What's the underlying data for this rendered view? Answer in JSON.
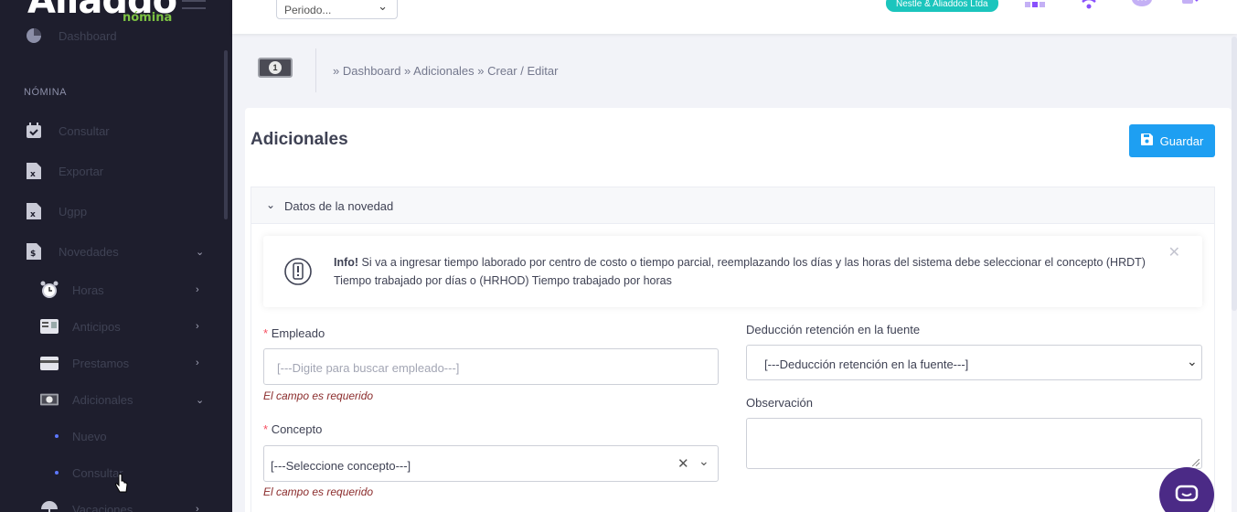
{
  "sidebar": {
    "logo": "Aliaddo",
    "logo_sub": "nómina",
    "top_item": "Dashboard",
    "section": "NÓMINA",
    "items": [
      {
        "label": "Consultar",
        "icon": "calendar-check-icon"
      },
      {
        "label": "Exportar",
        "icon": "excel-file-icon"
      },
      {
        "label": "Ugpp",
        "icon": "excel-file-icon"
      },
      {
        "label": "Novedades",
        "icon": "dollar-file-icon"
      }
    ],
    "novedades_items": [
      {
        "label": "Horas",
        "icon": "alarm-clock-icon"
      },
      {
        "label": "Anticipos",
        "icon": "id-card-icon"
      },
      {
        "label": "Prestamos",
        "icon": "credit-card-icon"
      },
      {
        "label": "Adicionales",
        "icon": "money-icon"
      }
    ],
    "adicionales_items": [
      {
        "label": "Nuevo"
      },
      {
        "label": "Consultar"
      }
    ],
    "bottom_item": "Vacaciones"
  },
  "header": {
    "periodo_placeholder": "Periodo...",
    "company": "Nestle & Aliaddos Ltda",
    "colors": {
      "company_badge": "#1bc5bd",
      "icon_purple": "#8950fc"
    }
  },
  "breadcrumb": "» Dashboard » Adicionales » Crear / Editar",
  "main": {
    "title": "Adicionales",
    "save_label": "Guardar",
    "panel_title": "Datos de la novedad",
    "info_title": "Info!",
    "info_text": " Si va a ingresar tiempo laborado por centro de costo o tiempo parcial, reemplazando los días y las horas del sistema debe seleccionar el concepto (HRDT) Tiempo trabajado por días o (HRHOD) Tiempo trabajado por horas",
    "empleado_label": "Empleado",
    "empleado_placeholder": "[---Digite para buscar empleado---]",
    "required_msg": "El campo es requerido",
    "concepto_label": "Concepto",
    "concepto_value": "[---Seleccione concepto---]",
    "deduccion_label": "Deducción retención en la fuente",
    "deduccion_value": "[---Deducción retención en la fuente---]",
    "observacion_label": "Observación",
    "required_mark": "*"
  },
  "colors": {
    "accent": "#1e9ff2",
    "sidebar_bg": "#1e1e2d",
    "required": "#f64e60",
    "error_text": "#8b2c2c"
  }
}
